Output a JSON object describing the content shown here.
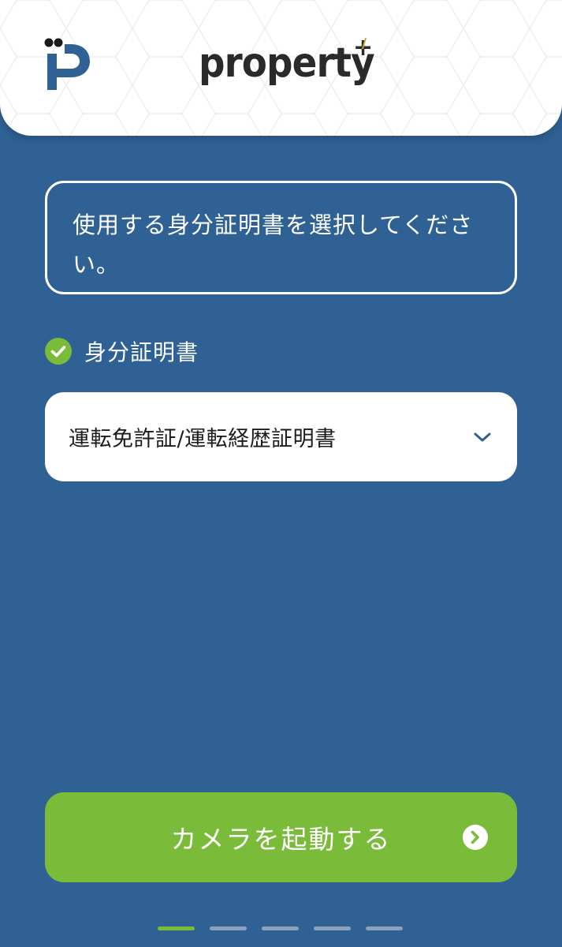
{
  "header": {
    "logo_icon": "property-plus-p-logo",
    "brand_name": "property",
    "brand_suffix": "+"
  },
  "instruction": {
    "text": "使用する身分証明書を選択してください。"
  },
  "section": {
    "icon": "check-circle-icon",
    "label": "身分証明書"
  },
  "document_select": {
    "value": "運転免許証/運転経歴証明書",
    "icon": "chevron-down-icon"
  },
  "primary_button": {
    "label": "カメラを起動する",
    "icon": "arrow-right-circle-icon"
  },
  "pager": {
    "total": 5,
    "active_index": 0
  },
  "colors": {
    "background": "#2f6194",
    "accent_green": "#7bbb3a",
    "header_bg": "#ffffff",
    "logo_blue": "#2f6194"
  }
}
